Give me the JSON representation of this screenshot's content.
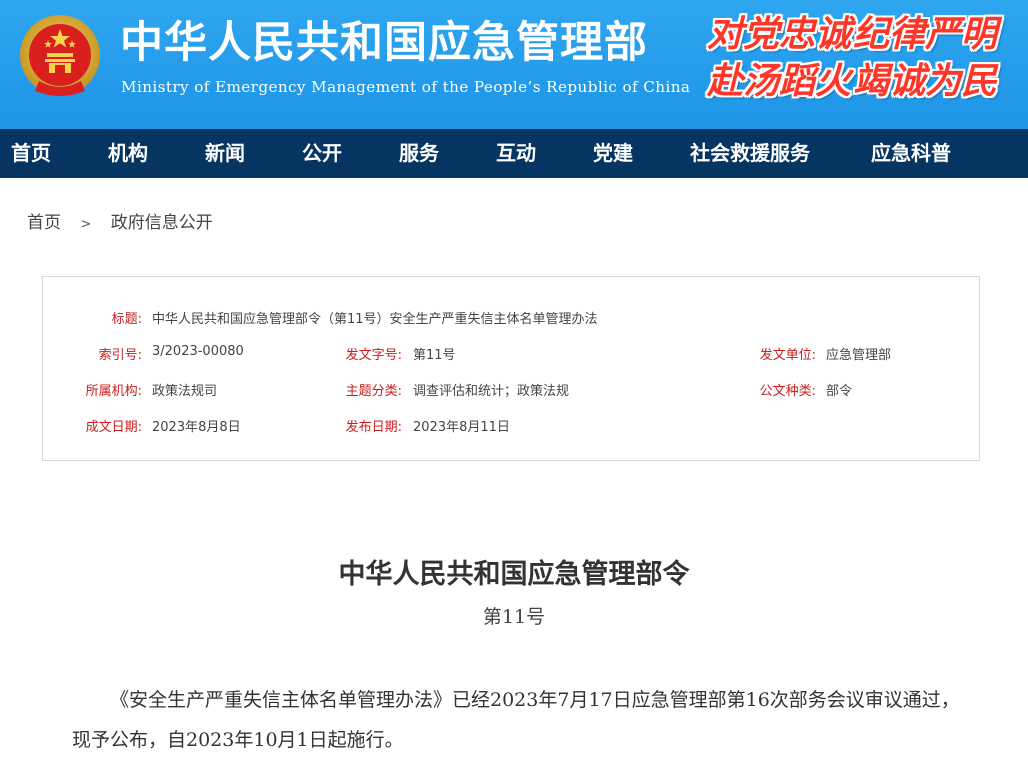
{
  "header": {
    "title": "中华人民共和国应急管理部",
    "subtitle": "Ministry of Emergency Management of the People’s Republic of China",
    "slogans": [
      "对党忠诚",
      "纪律严明",
      "赴汤蹈火",
      "竭诚为民"
    ],
    "colors": {
      "banner": "#1e95e6",
      "slogan": "#ff3528",
      "nav": "#063561"
    }
  },
  "nav": {
    "items": [
      "首页",
      "机构",
      "新闻",
      "公开",
      "服务",
      "互动",
      "党建",
      "社会救援服务",
      "应急科普"
    ]
  },
  "breadcrumb": {
    "home": "首页",
    "separator": ">",
    "current": "政府信息公开"
  },
  "meta": {
    "title_label": "标题:",
    "title_value": "中华人民共和国应急管理部令（第11号）安全生产严重失信主体名单管理办法",
    "index_label": "索引号:",
    "index_value": "3/2023-00080",
    "doc_no_label": "发文字号:",
    "doc_no_value": "第11号",
    "issuer_label": "发文单位:",
    "issuer_value": "应急管理部",
    "org_label": "所属机构:",
    "org_value": "政策法规司",
    "topic_label": "主题分类:",
    "topic_value": "调查评估和统计；政策法规",
    "type_label": "公文种类:",
    "type_value": "部令",
    "created_label": "成文日期:",
    "created_value": "2023年8月8日",
    "published_label": "发布日期:",
    "published_value": "2023年8月11日"
  },
  "article": {
    "title": "中华人民共和国应急管理部令",
    "number": "第11号",
    "body": "《安全生产严重失信主体名单管理办法》已经2023年7月17日应急管理部第16次部务会议审议通过，现予公布，自2023年10月1日起施行。"
  }
}
